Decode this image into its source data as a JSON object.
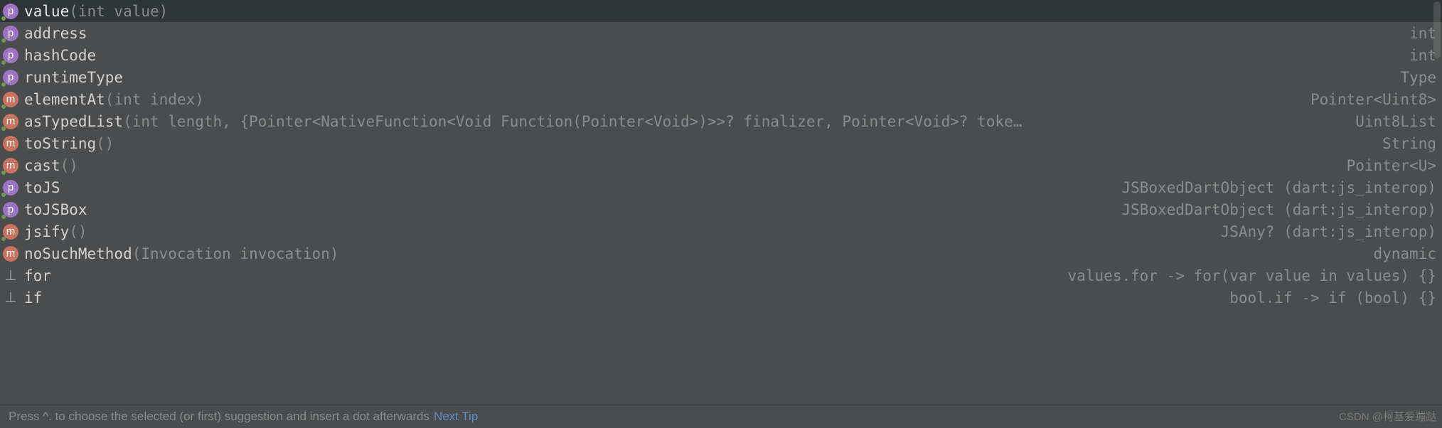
{
  "items": [
    {
      "icon": "p",
      "dot": true,
      "name": "value",
      "params": "(int value)",
      "ret": "",
      "selected": true
    },
    {
      "icon": "p",
      "dot": true,
      "name": "address",
      "params": "",
      "ret": "int"
    },
    {
      "icon": "p",
      "dot": true,
      "name": "hashCode",
      "params": "",
      "ret": "int"
    },
    {
      "icon": "p",
      "dot": true,
      "name": "runtimeType",
      "params": "",
      "ret": "Type"
    },
    {
      "icon": "m",
      "dot": true,
      "name": "elementAt",
      "params": "(int index)",
      "ret": "Pointer<Uint8>"
    },
    {
      "icon": "m",
      "dot": true,
      "name": "asTypedList",
      "params": "(int length, {Pointer<NativeFunction<Void Function(Pointer<Void>)>>? finalizer, Pointer<Void>? toke…",
      "ret": "Uint8List"
    },
    {
      "icon": "m",
      "dot": false,
      "name": "toString",
      "params": "()",
      "ret": "String"
    },
    {
      "icon": "m",
      "dot": true,
      "name": "cast",
      "params": "()",
      "ret": "Pointer<U>"
    },
    {
      "icon": "p",
      "dot": true,
      "name": "toJS",
      "params": "",
      "ret": "JSBoxedDartObject (dart:js_interop)"
    },
    {
      "icon": "p",
      "dot": true,
      "name": "toJSBox",
      "params": "",
      "ret": "JSBoxedDartObject (dart:js_interop)"
    },
    {
      "icon": "m",
      "dot": true,
      "name": "jsify",
      "params": "()",
      "ret": "JSAny? (dart:js_interop)"
    },
    {
      "icon": "m",
      "dot": false,
      "name": "noSuchMethod",
      "params": "(Invocation invocation)",
      "ret": "dynamic"
    },
    {
      "icon": "t",
      "dot": false,
      "name": "for",
      "params": "",
      "ret": "values.for -> for(var value in values) {}"
    },
    {
      "icon": "t",
      "dot": false,
      "name": "if",
      "params": "",
      "ret": "bool.if -> if (bool) {}"
    }
  ],
  "footer": {
    "hint": "Press ^. to choose the selected (or first) suggestion and insert a dot afterwards",
    "link": "Next Tip"
  },
  "watermark": "CSDN @柯基爱蹦跶",
  "iconGlyph": {
    "p": "p",
    "m": "m",
    "t": "⎵"
  },
  "templateGlyph": "⊥"
}
